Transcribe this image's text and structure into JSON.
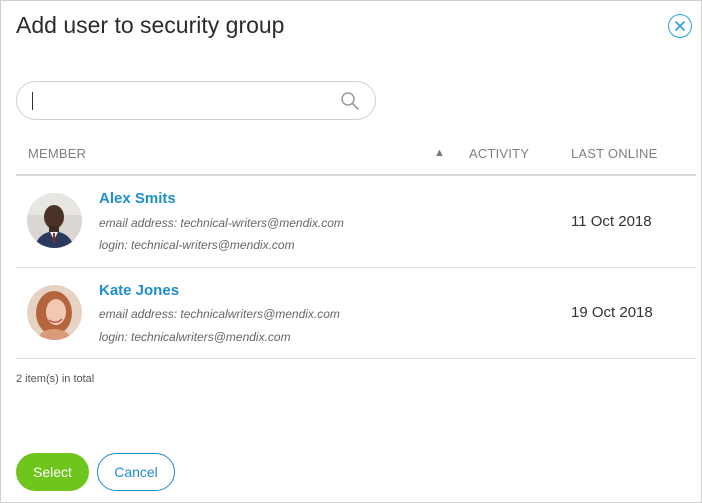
{
  "dialog": {
    "title": "Add user to security group",
    "close_icon": "close-circle-icon"
  },
  "search": {
    "value": "",
    "placeholder": "",
    "icon": "search-icon"
  },
  "table": {
    "columns": {
      "member": "MEMBER",
      "sort_indicator": "▲",
      "activity": "ACTIVITY",
      "last_online": "LAST ONLINE"
    },
    "rows": [
      {
        "name": "Alex Smits",
        "email_line": "email address: technical-writers@mendix.com",
        "login_line": "login: technical-writers@mendix.com",
        "last_online": "11 Oct 2018"
      },
      {
        "name": "Kate Jones",
        "email_line": "email address: technicalwriters@mendix.com",
        "login_line": "login: technicalwriters@mendix.com",
        "last_online": "19 Oct 2018"
      }
    ],
    "total_label": "2 item(s) in total"
  },
  "buttons": {
    "select": "Select",
    "cancel": "Cancel"
  },
  "colors": {
    "accent_blue": "#1e8fce",
    "select_green": "#6ec61c"
  }
}
